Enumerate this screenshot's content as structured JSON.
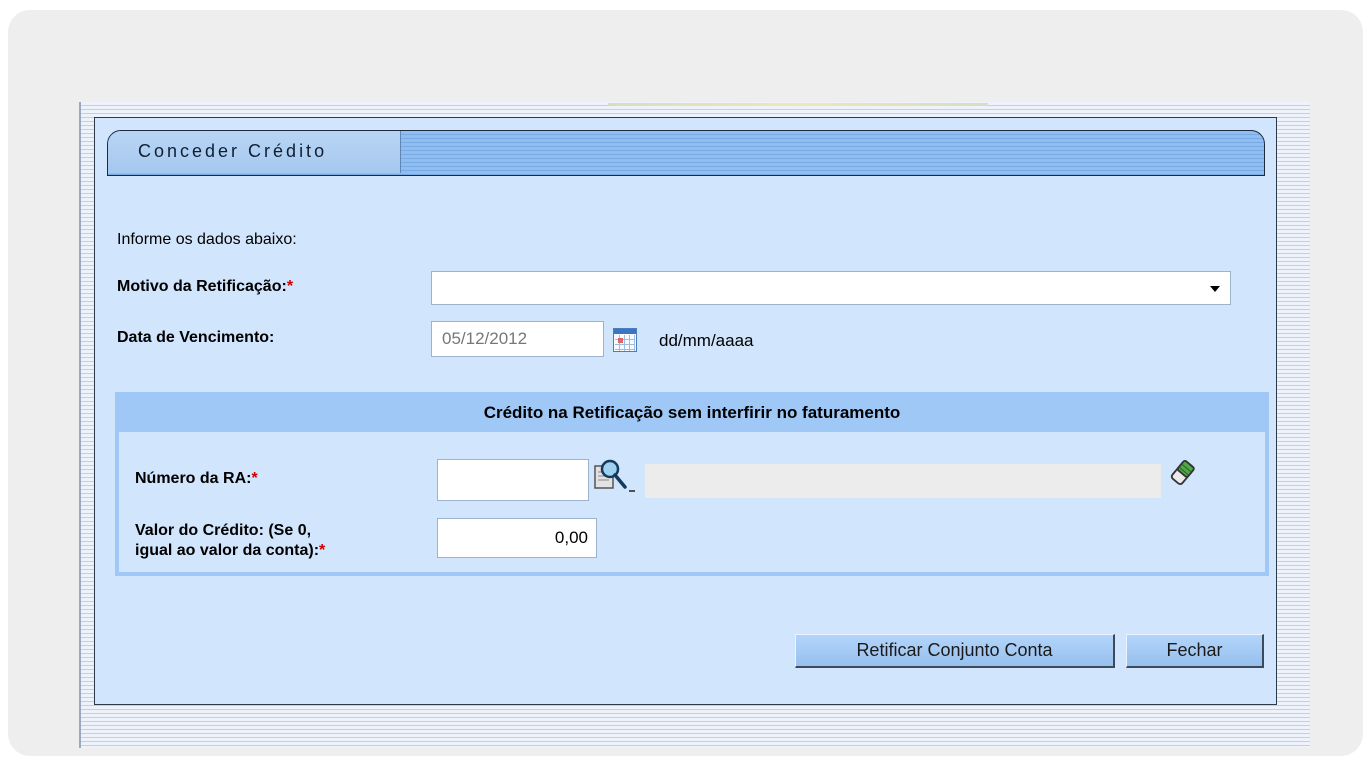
{
  "form": {
    "title": "Conceder Crédito",
    "instructions": "Informe os dados abaixo:",
    "motivo_label": "Motivo da Retificação:",
    "required_mark": "*",
    "motivo_value": "",
    "vencimento_label": "Data de Vencimento:",
    "vencimento_value": "05/12/2012",
    "date_format_hint": "dd/mm/aaaa"
  },
  "credit_section": {
    "header": "Crédito na Retificação sem interfirir no faturamento",
    "ra_label": "Número da RA:",
    "ra_value": "",
    "ra_description": "",
    "valor_label_line1": "Valor do Crédito: (Se 0,",
    "valor_label_line2": "igual ao valor da conta):",
    "valor_value": "0,00"
  },
  "buttons": {
    "retificar_label": "Retificar Conjunto Conta",
    "fechar_label": "Fechar"
  },
  "icons": {
    "calendar": "calendar-icon",
    "search": "magnifier-icon",
    "clear": "eraser-icon",
    "dropdown": "chevron-down-icon"
  },
  "colors": {
    "panel_bg": "#d1e5fc",
    "section_header_bg": "#a0c8f6",
    "button_bg": "#a6cbf4",
    "required": "#cc0000"
  }
}
